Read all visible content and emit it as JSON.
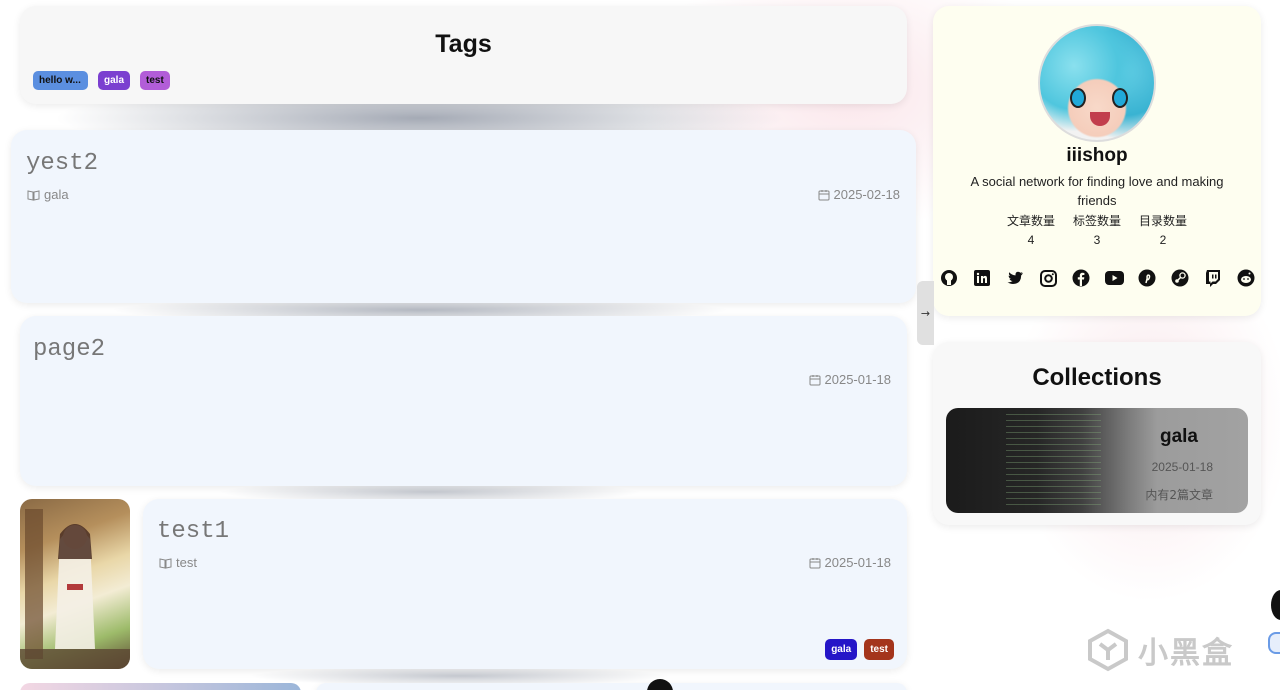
{
  "tags_card": {
    "title": "Tags",
    "tags": [
      {
        "label": "hello w...",
        "color": "#5b8fe0"
      },
      {
        "label": "gala",
        "color": "#7b3fd0"
      },
      {
        "label": "test",
        "color": "#b25dd8"
      }
    ]
  },
  "posts": [
    {
      "title": "yest2",
      "category": "gala",
      "date": "2025-02-18",
      "tags": []
    },
    {
      "title": "page2",
      "category": "",
      "date": "2025-01-18",
      "tags": []
    },
    {
      "title": "test1",
      "category": "test",
      "date": "2025-01-18",
      "tags": [
        {
          "label": "gala",
          "color": "#2516c8"
        },
        {
          "label": "test",
          "color": "#a4351c"
        }
      ]
    }
  ],
  "toggle": {
    "label": "→"
  },
  "profile": {
    "name": "iiishop",
    "description": "A social network for finding love and making friends",
    "stats": [
      {
        "label": "文章数量",
        "value": "4"
      },
      {
        "label": "标签数量",
        "value": "3"
      },
      {
        "label": "目录数量",
        "value": "2"
      }
    ],
    "social_icons": [
      "github-icon",
      "linkedin-icon",
      "twitter-icon",
      "instagram-icon",
      "facebook-icon",
      "youtube-icon",
      "pinterest-icon",
      "steam-icon",
      "twitch-icon",
      "reddit-icon"
    ]
  },
  "collections": {
    "title": "Collections",
    "items": [
      {
        "name": "gala",
        "date": "2025-01-18",
        "count": "内有2篇文章"
      }
    ]
  },
  "watermark": {
    "text": "小黑盒"
  }
}
